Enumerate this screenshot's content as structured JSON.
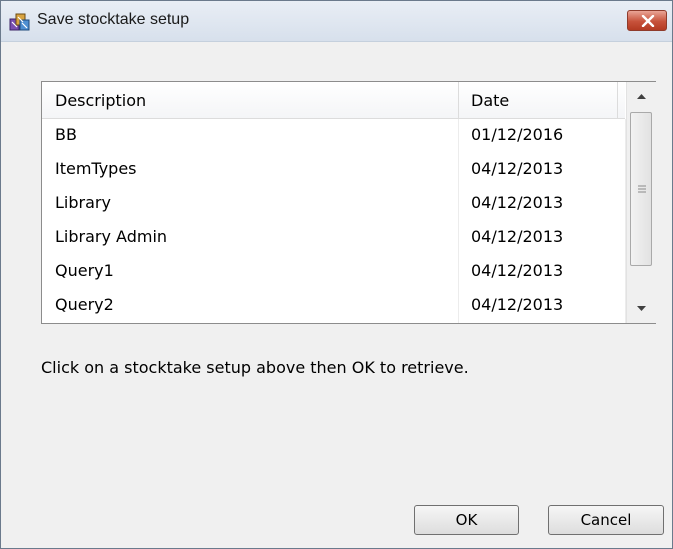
{
  "window": {
    "title": "Save stocktake setup"
  },
  "list": {
    "columns": [
      "Description",
      "Date"
    ],
    "rows": [
      {
        "description": "BB",
        "date": "01/12/2016"
      },
      {
        "description": "ItemTypes",
        "date": "04/12/2013"
      },
      {
        "description": "Library",
        "date": "04/12/2013"
      },
      {
        "description": "Library Admin",
        "date": "04/12/2013"
      },
      {
        "description": "Query1",
        "date": "04/12/2013"
      },
      {
        "description": "Query2",
        "date": "04/12/2013"
      }
    ]
  },
  "hint": "Click on a stocktake setup above then OK to retrieve.",
  "buttons": {
    "ok": "OK",
    "cancel": "Cancel"
  },
  "colors": {
    "title_bar": "#dde5ef",
    "close_button": "#c7523b",
    "dialog_bg": "#f0f0f0"
  }
}
